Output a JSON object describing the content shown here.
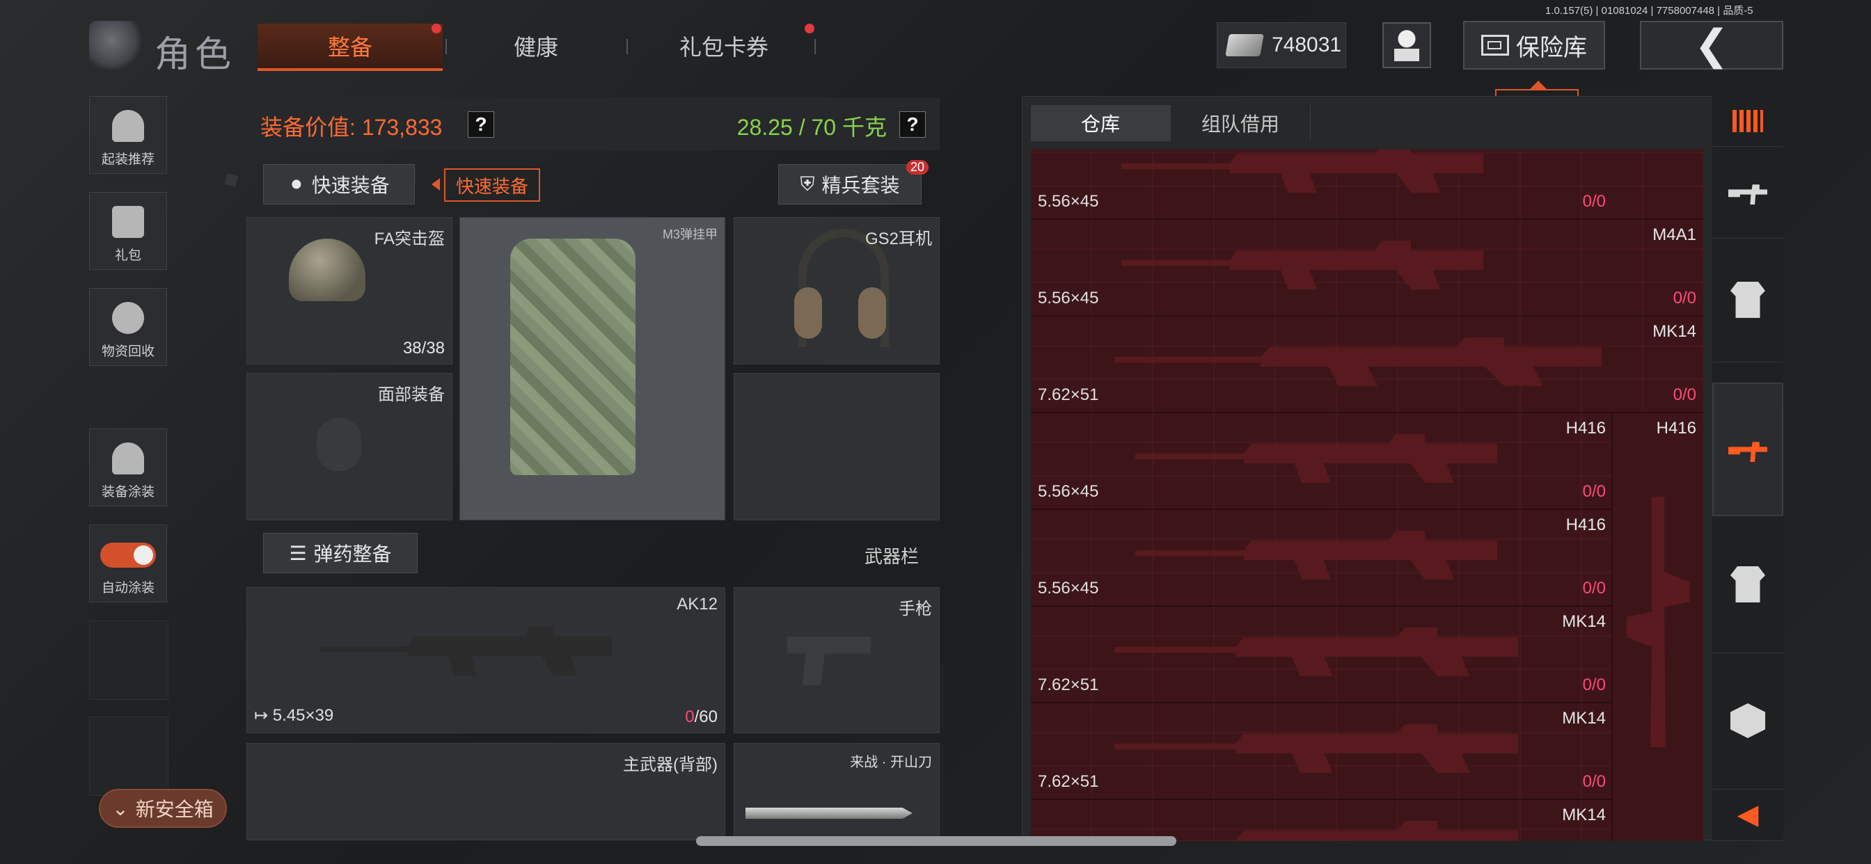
{
  "version": "1.0.157(5) | 01081024 | 7758007448 | 品质-5",
  "header": {
    "title": "角色",
    "tabs": [
      {
        "label": "整备",
        "active": true,
        "dot": true
      },
      {
        "label": "健康",
        "active": false,
        "dot": false
      },
      {
        "label": "礼包卡券",
        "active": false,
        "dot": true
      }
    ],
    "currency": "748031",
    "vault_label": "保险库",
    "vault_tooltip": "保险库",
    "back_icon": "chevron-left-icon"
  },
  "sidebar": {
    "items": [
      {
        "label": "起装推荐",
        "icon": "helmet-gear-icon"
      },
      {
        "label": "礼包",
        "icon": "gift-icon"
      },
      {
        "label": "物资回收",
        "icon": "recycle-icon"
      },
      {
        "label": "装备涂装",
        "icon": "paint-icon"
      },
      {
        "label": "自动涂装",
        "icon": "toggle-icon",
        "toggle_on": true
      }
    ],
    "safebox_label": "新安全箱"
  },
  "loadout": {
    "value_label": "装备价值: 173,833",
    "weight_label": "28.25 / 70 千克",
    "help": "?",
    "quick_equip": "快速装备",
    "quick_equip_tip": "快速装备",
    "elite_kit": "精兵套装",
    "elite_badge": "20",
    "slots": {
      "helmet": {
        "name": "FA突击盔",
        "durability": "38/38"
      },
      "vest": {
        "name": "M3弹挂甲"
      },
      "headset": {
        "name": "GS2耳机"
      },
      "face": {
        "name": "面部装备"
      }
    },
    "ammo_button": "弹药整备",
    "weapon_section": "武器栏",
    "primary": {
      "name": "AK12",
      "caliber": "5.45×39",
      "ammo_current": "0",
      "ammo_max": "/60"
    },
    "pistol": {
      "name": "手枪"
    },
    "back_weapon": {
      "name": "主武器(背部)"
    },
    "melee": {
      "name": "来战 · 开山刀"
    }
  },
  "inventory": {
    "tabs": [
      "仓库",
      "组队借用"
    ],
    "items": [
      {
        "name": "",
        "caliber": "5.56×45",
        "count_current": "0",
        "count_total": "/0"
      },
      {
        "name": "M4A1",
        "caliber": "5.56×45",
        "count_current": "0",
        "count_total": "/0"
      },
      {
        "name": "MK14",
        "caliber": "7.62×51",
        "count_current": "0",
        "count_total": "/0"
      },
      {
        "name": "H416",
        "caliber": "5.56×45",
        "count_current": "0",
        "count_total": "/0"
      },
      {
        "name": "H416",
        "caliber": "5.56×45",
        "count_current": "0",
        "count_total": "/0"
      },
      {
        "name": "MK14",
        "caliber": "7.62×51",
        "count_current": "0",
        "count_total": "/0"
      },
      {
        "name": "MK14",
        "caliber": "7.62×51",
        "count_current": "0",
        "count_total": "/0"
      },
      {
        "name": "MK14",
        "caliber": "",
        "count_current": "",
        "count_total": ""
      }
    ],
    "side_item": {
      "name": "H416"
    }
  },
  "rail": [
    "sort-icon",
    "rifle-icon",
    "armor-icon",
    "rifle-icon-active",
    "armor-icon",
    "box-icon",
    "arrow-left-icon"
  ],
  "colors": {
    "accent": "#ff5a20",
    "value": "#ff6a32",
    "weight": "#8bd34a",
    "ammo_zero": "#ff4a7a"
  }
}
